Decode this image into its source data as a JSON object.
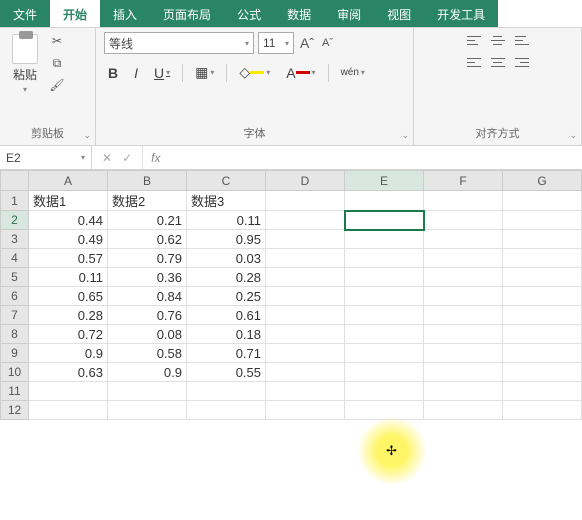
{
  "tabs": {
    "file": "文件",
    "home": "开始",
    "insert": "插入",
    "layout": "页面布局",
    "formula": "公式",
    "data": "数据",
    "review": "审阅",
    "view": "视图",
    "dev": "开发工具"
  },
  "ribbon": {
    "clipboard": {
      "title": "剪贴板",
      "paste": "粘贴"
    },
    "font": {
      "title": "字体",
      "name": "等线",
      "size": "11",
      "bold": "B",
      "italic": "I",
      "underline": "U",
      "wen": "wén"
    },
    "align": {
      "title": "对齐方式"
    }
  },
  "namebox": "E2",
  "grid": {
    "cols": [
      "A",
      "B",
      "C",
      "D",
      "E",
      "F",
      "G"
    ],
    "rows": [
      "1",
      "2",
      "3",
      "4",
      "5",
      "6",
      "7",
      "8",
      "9",
      "10",
      "11",
      "12"
    ],
    "headers": [
      "数据1",
      "数据2",
      "数据3"
    ],
    "data": [
      [
        "0.44",
        "0.21",
        "0.11"
      ],
      [
        "0.49",
        "0.62",
        "0.95"
      ],
      [
        "0.57",
        "0.79",
        "0.03"
      ],
      [
        "0.11",
        "0.36",
        "0.28"
      ],
      [
        "0.65",
        "0.84",
        "0.25"
      ],
      [
        "0.28",
        "0.76",
        "0.61"
      ],
      [
        "0.72",
        "0.08",
        "0.18"
      ],
      [
        "0.9",
        "0.58",
        "0.71"
      ],
      [
        "0.63",
        "0.9",
        "0.55"
      ]
    ]
  }
}
